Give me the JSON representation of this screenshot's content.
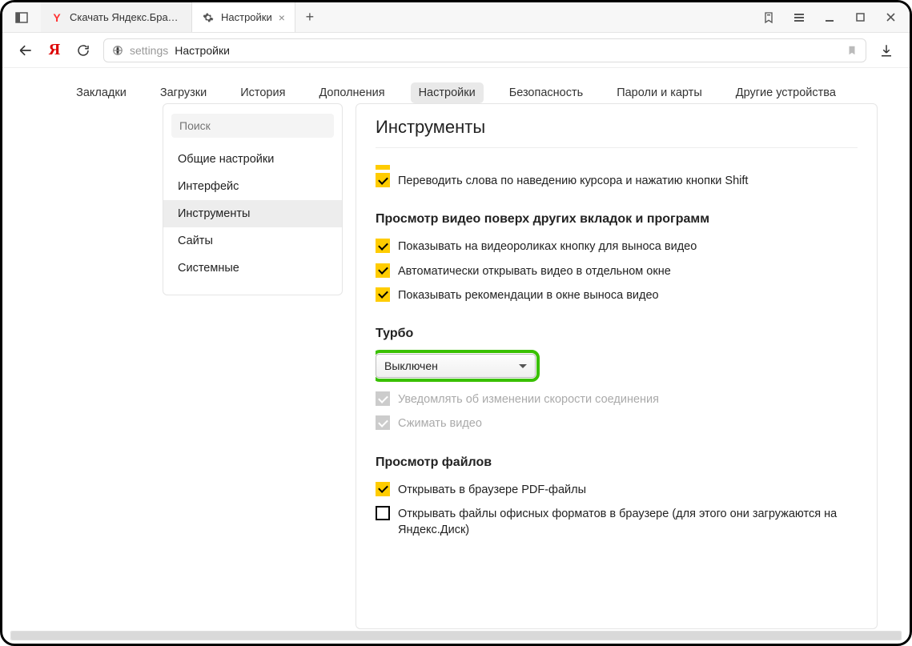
{
  "titlebar": {
    "tabs": [
      {
        "label": "Скачать Яндекс.Браузер д",
        "favicon": "Y"
      },
      {
        "label": "Настройки",
        "favicon": "gear"
      }
    ],
    "newtab": "+"
  },
  "addressbar": {
    "path1": "settings",
    "path2": "Настройки"
  },
  "topnav": {
    "items": [
      "Закладки",
      "Загрузки",
      "История",
      "Дополнения",
      "Настройки",
      "Безопасность",
      "Пароли и карты",
      "Другие устройства"
    ],
    "active_index": 4
  },
  "sidebar": {
    "search_placeholder": "Поиск",
    "items": [
      "Общие настройки",
      "Интерфейс",
      "Инструменты",
      "Сайты",
      "Системные"
    ],
    "active_index": 2
  },
  "content": {
    "page_title": "Инструменты",
    "translate_shift": "Переводить слова по наведению курсора и нажатию кнопки Shift",
    "section_video_title": "Просмотр видео поверх других вкладок и программ",
    "video_opts": [
      "Показывать на видеороликах кнопку для выноса видео",
      "Автоматически открывать видео в отдельном окне",
      "Показывать рекомендации в окне выноса видео"
    ],
    "section_turbo_title": "Турбо",
    "turbo_value": "Выключен",
    "turbo_disabled": [
      "Уведомлять об изменении скорости соединения",
      "Сжимать видео"
    ],
    "section_files_title": "Просмотр файлов",
    "files_pdf": "Открывать в браузере PDF-файлы",
    "files_office": "Открывать файлы офисных форматов в браузере (для этого они загружаются на Яндекс.Диск)"
  }
}
